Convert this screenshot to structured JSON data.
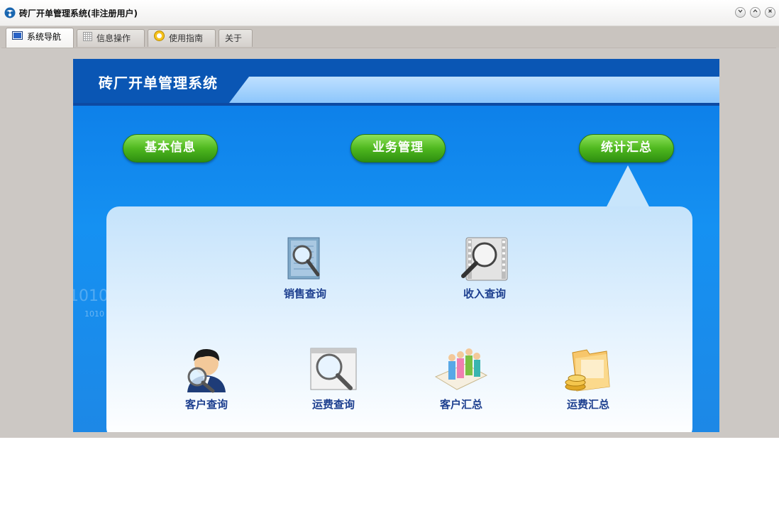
{
  "window": {
    "title": "砖厂开单管理系统(非注册用户)"
  },
  "tabs": [
    {
      "label": "系统导航",
      "icon": "monitor-icon",
      "active": true
    },
    {
      "label": "信息操作",
      "icon": "grid-icon",
      "active": false
    },
    {
      "label": "使用指南",
      "icon": "help-icon",
      "active": false
    },
    {
      "label": "关于",
      "icon": "",
      "active": false
    }
  ],
  "panel": {
    "system_title": "砖厂开单管理系统",
    "bg_digits": "1010",
    "bg_digits_small": "1010"
  },
  "nav_buttons": [
    {
      "label": "基本信息"
    },
    {
      "label": "业务管理"
    },
    {
      "label": "统计汇总"
    }
  ],
  "functions": [
    {
      "label": "销售查询",
      "icon": "document-search-icon"
    },
    {
      "label": "收入查询",
      "icon": "film-search-icon"
    },
    {
      "label": "客户查询",
      "icon": "user-search-icon"
    },
    {
      "label": "运费查询",
      "icon": "window-search-icon"
    },
    {
      "label": "客户汇总",
      "icon": "people-chart-icon"
    },
    {
      "label": "运费汇总",
      "icon": "folder-coins-icon"
    }
  ],
  "colors": {
    "panel_blue": "#1591f2",
    "header_blue": "#0a56b4",
    "button_green": "#4fb81f",
    "label_blue": "#1d3f8f"
  }
}
